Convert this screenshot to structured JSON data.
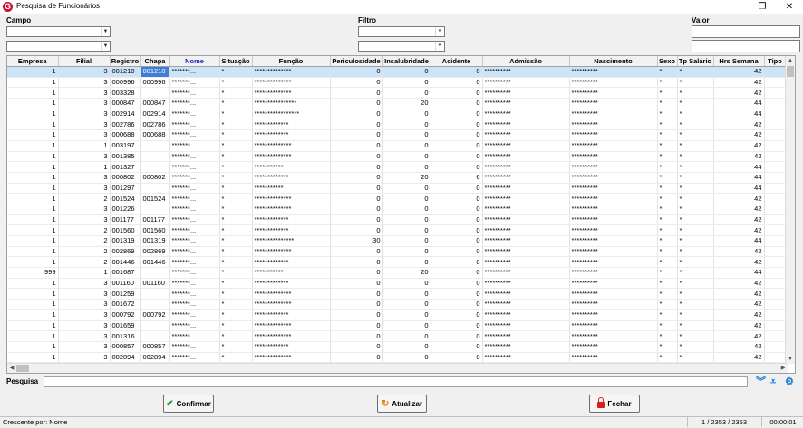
{
  "window": {
    "title": "Pesquisa de Funcionários",
    "logo_letter": "G"
  },
  "filters": {
    "campo_label": "Campo",
    "filtro_label": "Filtro",
    "valor_label": "Valor"
  },
  "grid": {
    "columns": [
      "Empresa",
      "Filial",
      "Registro",
      "Chapa",
      "Nome",
      "Situação",
      "Função",
      "Periculosidade",
      "Insalubridade",
      "Acidente",
      "Admissão",
      "Nascimento",
      "Sexo",
      "Tp Salário",
      "Hrs Semana",
      "Tipo"
    ],
    "sorted_column": "Nome",
    "rows": [
      [
        "1",
        "3",
        "001210",
        "001210",
        "*******...",
        "*",
        "**************",
        "0",
        "0",
        "0",
        "**********",
        "**********",
        "*",
        "*",
        "42",
        ""
      ],
      [
        "1",
        "3",
        "000996",
        "000996",
        "*******...",
        "*",
        "**************",
        "0",
        "0",
        "0",
        "**********",
        "**********",
        "*",
        "*",
        "42",
        ""
      ],
      [
        "1",
        "3",
        "003328",
        "",
        "*******...",
        "*",
        "**************",
        "0",
        "0",
        "0",
        "**********",
        "**********",
        "*",
        "*",
        "42",
        ""
      ],
      [
        "1",
        "3",
        "000847",
        "000847",
        "*******...",
        "*",
        "****************",
        "0",
        "20",
        "0",
        "**********",
        "**********",
        "*",
        "*",
        "44",
        ""
      ],
      [
        "1",
        "3",
        "002914",
        "002914",
        "*******...",
        "*",
        "*****************",
        "0",
        "0",
        "0",
        "**********",
        "**********",
        "*",
        "*",
        "44",
        ""
      ],
      [
        "1",
        "3",
        "002786",
        "002786",
        "*******...",
        "*",
        "*************",
        "0",
        "0",
        "0",
        "**********",
        "**********",
        "*",
        "*",
        "42",
        ""
      ],
      [
        "1",
        "3",
        "000688",
        "000688",
        "*******...",
        "*",
        "*************",
        "0",
        "0",
        "0",
        "**********",
        "**********",
        "*",
        "*",
        "42",
        ""
      ],
      [
        "1",
        "1",
        "003197",
        "",
        "*******...",
        "*",
        "**************",
        "0",
        "0",
        "0",
        "**********",
        "**********",
        "*",
        "*",
        "42",
        ""
      ],
      [
        "1",
        "3",
        "001385",
        "",
        "*******...",
        "*",
        "**************",
        "0",
        "0",
        "0",
        "**********",
        "**********",
        "*",
        "*",
        "42",
        ""
      ],
      [
        "1",
        "1",
        "001327",
        "",
        "*******...",
        "*",
        "***********",
        "0",
        "0",
        "0",
        "**********",
        "**********",
        "*",
        "*",
        "44",
        ""
      ],
      [
        "1",
        "3",
        "000802",
        "000802",
        "*******...",
        "*",
        "*************",
        "0",
        "20",
        "6",
        "**********",
        "**********",
        "*",
        "*",
        "44",
        ""
      ],
      [
        "1",
        "3",
        "001297",
        "",
        "*******...",
        "*",
        "***********",
        "0",
        "0",
        "0",
        "**********",
        "**********",
        "*",
        "*",
        "44",
        ""
      ],
      [
        "1",
        "2",
        "001524",
        "001524",
        "*******...",
        "*",
        "**************",
        "0",
        "0",
        "0",
        "**********",
        "**********",
        "*",
        "*",
        "42",
        ""
      ],
      [
        "1",
        "3",
        "001226",
        "",
        "*******...",
        "*",
        "**************",
        "0",
        "0",
        "0",
        "**********",
        "**********",
        "*",
        "*",
        "42",
        ""
      ],
      [
        "1",
        "3",
        "001177",
        "001177",
        "*******...",
        "*",
        "*************",
        "0",
        "0",
        "0",
        "**********",
        "**********",
        "*",
        "*",
        "42",
        ""
      ],
      [
        "1",
        "2",
        "001560",
        "001560",
        "*******...",
        "*",
        "*************",
        "0",
        "0",
        "0",
        "**********",
        "**********",
        "*",
        "*",
        "42",
        ""
      ],
      [
        "1",
        "2",
        "001319",
        "001319",
        "*******...",
        "*",
        "***************",
        "30",
        "0",
        "0",
        "**********",
        "**********",
        "*",
        "*",
        "44",
        ""
      ],
      [
        "1",
        "2",
        "002869",
        "002869",
        "*******...",
        "*",
        "**************",
        "0",
        "0",
        "0",
        "**********",
        "**********",
        "*",
        "*",
        "42",
        ""
      ],
      [
        "1",
        "2",
        "001446",
        "001446",
        "*******...",
        "*",
        "*************",
        "0",
        "0",
        "0",
        "**********",
        "**********",
        "*",
        "*",
        "42",
        ""
      ],
      [
        "999",
        "1",
        "001687",
        "",
        "*******...",
        "*",
        "***********",
        "0",
        "20",
        "0",
        "**********",
        "**********",
        "*",
        "*",
        "44",
        ""
      ],
      [
        "1",
        "3",
        "001160",
        "001160",
        "*******...",
        "*",
        "*************",
        "0",
        "0",
        "0",
        "**********",
        "**********",
        "*",
        "*",
        "42",
        ""
      ],
      [
        "1",
        "3",
        "001259",
        "",
        "*******...",
        "*",
        "**************",
        "0",
        "0",
        "0",
        "**********",
        "**********",
        "*",
        "*",
        "42",
        ""
      ],
      [
        "1",
        "3",
        "001672",
        "",
        "*******...",
        "*",
        "**************",
        "0",
        "0",
        "0",
        "**********",
        "**********",
        "*",
        "*",
        "42",
        ""
      ],
      [
        "1",
        "3",
        "000792",
        "000792",
        "*******...",
        "*",
        "*************",
        "0",
        "0",
        "0",
        "**********",
        "**********",
        "*",
        "*",
        "42",
        ""
      ],
      [
        "1",
        "3",
        "001659",
        "",
        "*******...",
        "*",
        "**************",
        "0",
        "0",
        "0",
        "**********",
        "**********",
        "*",
        "*",
        "42",
        ""
      ],
      [
        "1",
        "3",
        "001316",
        "",
        "*******...",
        "*",
        "**************",
        "0",
        "0",
        "0",
        "**********",
        "**********",
        "*",
        "*",
        "42",
        ""
      ],
      [
        "1",
        "3",
        "000857",
        "000857",
        "*******...",
        "*",
        "*************",
        "0",
        "0",
        "0",
        "**********",
        "**********",
        "*",
        "*",
        "42",
        ""
      ],
      [
        "1",
        "3",
        "002894",
        "002894",
        "*******...",
        "*",
        "**************",
        "0",
        "0",
        "0",
        "**********",
        "**********",
        "*",
        "*",
        "42",
        ""
      ]
    ]
  },
  "search": {
    "label": "Pesquisa"
  },
  "buttons": {
    "confirm": "Confirmar",
    "refresh": "Atualizar",
    "close": "Fechar"
  },
  "status": {
    "sort_text": "Crescente por: Nome",
    "record_count": "1 / 2353 / 2353",
    "elapsed": "00:00:01"
  },
  "icons": {
    "expand_all": "double-chevron-down-icon",
    "expand_last": "chevron-down-bar-icon",
    "settings": "gear-icon"
  }
}
